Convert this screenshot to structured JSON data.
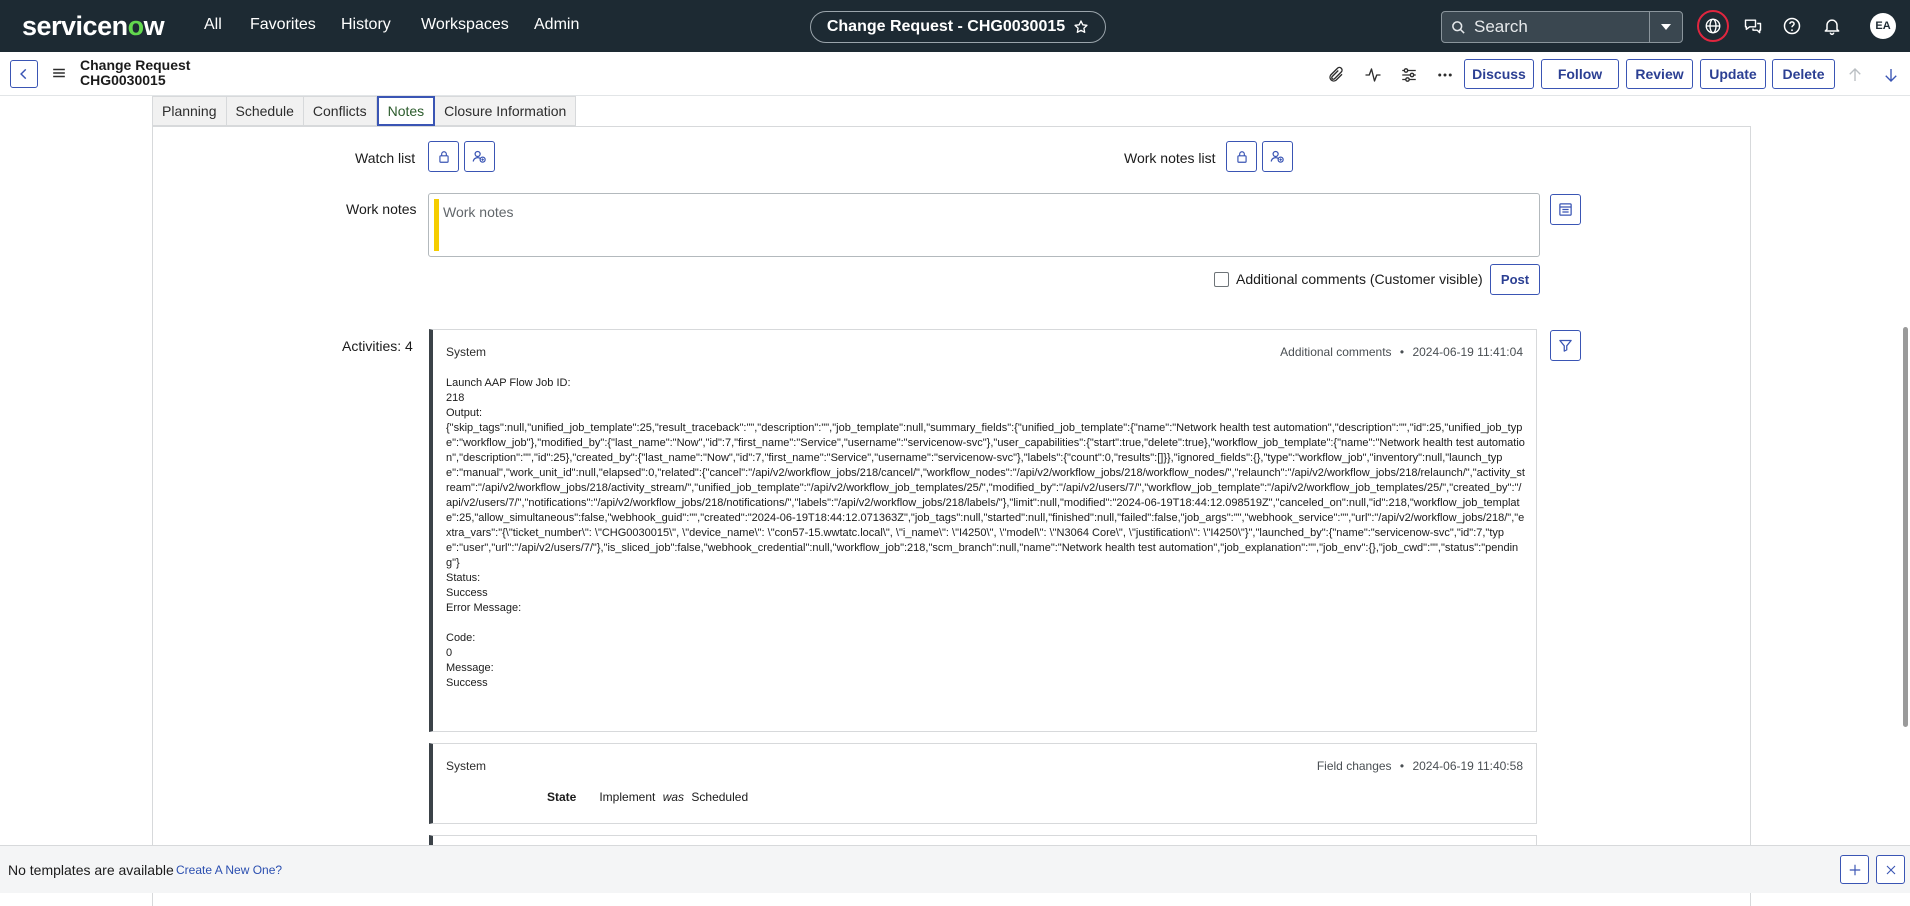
{
  "top_nav": {
    "logo": "servicenow",
    "links": [
      "All",
      "Favorites",
      "History",
      "Workspaces",
      "Admin"
    ],
    "context_title": "Change Request - CHG0030015",
    "search_placeholder": "Search",
    "avatar_initials": "EA",
    "icons": [
      "star-icon",
      "globe-icon",
      "chat-icon",
      "help-icon",
      "bell-icon"
    ]
  },
  "form_header": {
    "title_line1": "Change Request",
    "title_line2": "CHG0030015",
    "buttons": [
      "Discuss",
      "Follow",
      "Review",
      "Update",
      "Delete"
    ],
    "icons": [
      "paperclip-icon",
      "activity-icon",
      "sliders-icon",
      "more-icon",
      "arrow-up-icon",
      "arrow-down-icon"
    ]
  },
  "tabs": [
    "Planning",
    "Schedule",
    "Conflicts",
    "Notes",
    "Closure Information"
  ],
  "active_tab": "Notes",
  "notes": {
    "watch_list_label": "Watch list",
    "work_notes_list_label": "Work notes list",
    "work_notes_label": "Work notes",
    "work_notes_placeholder": "Work notes",
    "additional_comments_label": "Additional comments (Customer visible)",
    "additional_comments_checked": false,
    "post_label": "Post",
    "activities_label": "Activities: 4"
  },
  "activities": [
    {
      "author": "System",
      "type": "Additional comments",
      "timestamp": "2024-06-19 11:41:04",
      "body": "Launch AAP Flow Job ID:\n218\nOutput:\n{\"skip_tags\":null,\"unified_job_template\":25,\"result_traceback\":\"\",\"description\":\"\",\"job_template\":null,\"summary_fields\":{\"unified_job_template\":{\"name\":\"Network health test automation\",\"description\":\"\",\"id\":25,\"unified_job_type\":\"workflow_job\"},\"modified_by\":{\"last_name\":\"Now\",\"id\":7,\"first_name\":\"Service\",\"username\":\"servicenow-svc\"},\"user_capabilities\":{\"start\":true,\"delete\":true},\"workflow_job_template\":{\"name\":\"Network health test automation\",\"description\":\"\",\"id\":25},\"created_by\":{\"last_name\":\"Now\",\"id\":7,\"first_name\":\"Service\",\"username\":\"servicenow-svc\"},\"labels\":{\"count\":0,\"results\":[]}},\"ignored_fields\":{},\"type\":\"workflow_job\",\"inventory\":null,\"launch_type\":\"manual\",\"work_unit_id\":null,\"elapsed\":0,\"related\":{\"cancel\":\"/api/v2/workflow_jobs/218/cancel/\",\"workflow_nodes\":\"/api/v2/workflow_jobs/218/workflow_nodes/\",\"relaunch\":\"/api/v2/workflow_jobs/218/relaunch/\",\"activity_stream\":\"/api/v2/workflow_jobs/218/activity_stream/\",\"unified_job_template\":\"/api/v2/workflow_job_templates/25/\",\"modified_by\":\"/api/v2/users/7/\",\"workflow_job_template\":\"/api/v2/workflow_job_templates/25/\",\"created_by\":\"/api/v2/users/7/\",\"notifications\":\"/api/v2/workflow_jobs/218/notifications/\",\"labels\":\"/api/v2/workflow_jobs/218/labels/\"},\"limit\":null,\"modified\":\"2024-06-19T18:44:12.098519Z\",\"canceled_on\":null,\"id\":218,\"workflow_job_template\":25,\"allow_simultaneous\":false,\"webhook_guid\":\"\",\"created\":\"2024-06-19T18:44:12.071363Z\",\"job_tags\":null,\"started\":null,\"finished\":null,\"failed\":false,\"job_args\":\"\",\"webhook_service\":\"\",\"url\":\"/api/v2/workflow_jobs/218/\",\"extra_vars\":\"{\\\"ticket_number\\\": \\\"CHG0030015\\\", \\\"device_name\\\": \\\"con57-15.wwtatc.local\\\", \\\"i_name\\\": \\\"I4250\\\", \\\"model\\\": \\\"N3064 Core\\\", \\\"justification\\\": \\\"I4250\\\"}\",\"launched_by\":{\"name\":\"servicenow-svc\",\"id\":7,\"type\":\"user\",\"url\":\"/api/v2/users/7/\"},\"is_sliced_job\":false,\"webhook_credential\":null,\"workflow_job\":218,\"scm_branch\":null,\"name\":\"Network health test automation\",\"job_explanation\":\"\",\"job_env\":{},\"job_cwd\":\"\",\"status\":\"pending\"}\nStatus:\nSuccess\nError Message:\n\nCode:\n0\nMessage:\nSuccess"
    },
    {
      "author": "System",
      "type": "Field changes",
      "timestamp": "2024-06-19 11:40:58",
      "field": "State",
      "new_value": "Implement",
      "was_label": "was",
      "old_value": "Scheduled"
    }
  ],
  "bottom_bar": {
    "no_templates": "No templates are available",
    "create_link": "Create A New One?"
  },
  "colors": {
    "nav_bg": "#1d2a33",
    "accent": "#3a55b4",
    "work_notes_bar": "#f5cd00",
    "globe_ring": "#e0263f",
    "logo_accent": "#62d84e"
  }
}
